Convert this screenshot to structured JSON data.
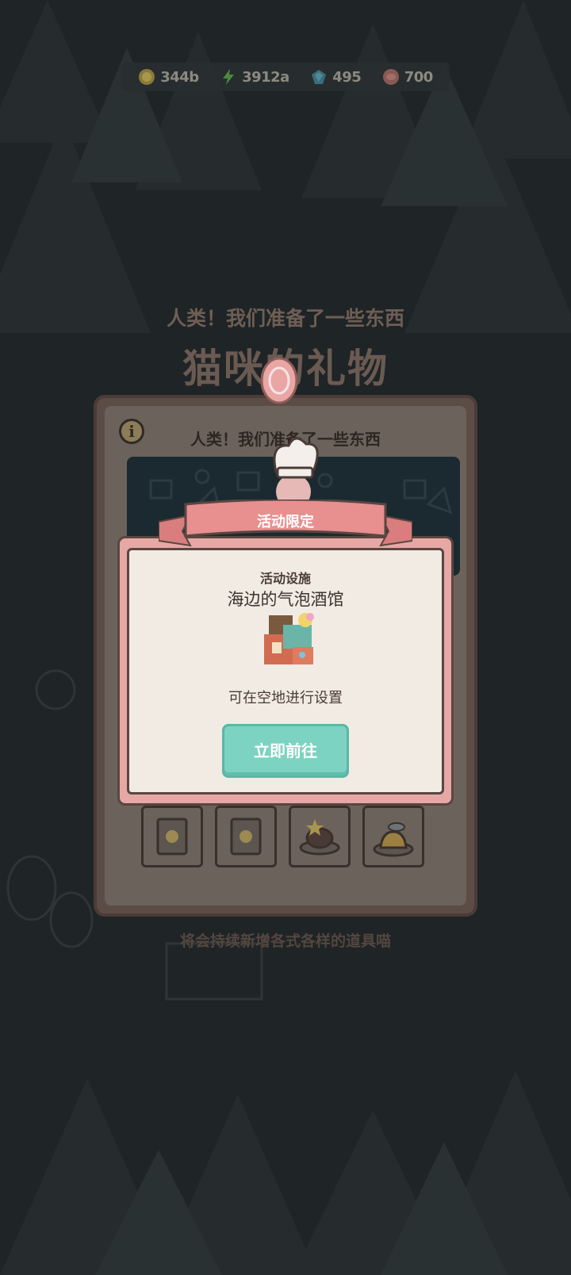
{
  "colors": {
    "background": "#1f2426",
    "popup_frame": "#e7a8a5",
    "popup_body": "#f1ebe4",
    "ribbon": "#e88f90",
    "button": "#7dd3c1"
  },
  "currency": [
    {
      "icon": "gold-coin-icon",
      "value": "344b"
    },
    {
      "icon": "lightning-energy-icon",
      "value": "3912a"
    },
    {
      "icon": "blue-gem-icon",
      "value": "495"
    },
    {
      "icon": "fish-token-icon",
      "value": "700"
    }
  ],
  "header": {
    "subtitle": "人类！我们准备了一些东西",
    "title": "猫咪的礼物"
  },
  "gift_panel": {
    "heading": "人类！我们准备了一些东西",
    "info_icon": "i",
    "slots": [
      {
        "icon": "moon-ticket-icon"
      },
      {
        "icon": "moon-ticket-icon"
      },
      {
        "icon": "star-cake-icon"
      },
      {
        "icon": "fish-pudding-icon"
      }
    ]
  },
  "bottom_note": "将会持续新增各式各样的道具喵",
  "popup": {
    "ribbon": "活动限定",
    "category": "活动设施",
    "name": "海边的气泡酒馆",
    "facility_icon": "bubble-tavern-icon",
    "description": "可在空地进行设置",
    "button": "立即前往"
  }
}
